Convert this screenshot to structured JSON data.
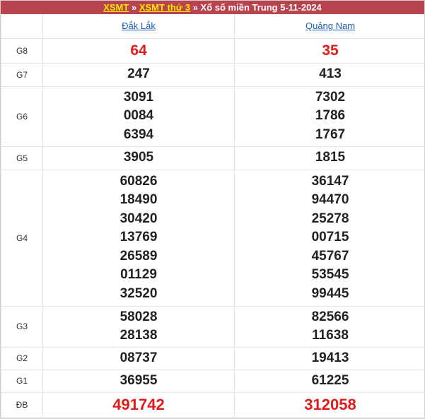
{
  "header": {
    "link1": "XSMT",
    "sep1": "»",
    "link2": "XSMT thứ 3",
    "sep2": "»",
    "title": "Xổ số miền Trung 5-11-2024"
  },
  "provinces": [
    "Đắk Lắk",
    "Quảng Nam"
  ],
  "prizes": [
    {
      "label": "G8",
      "dl": [
        "64"
      ],
      "qn": [
        "35"
      ]
    },
    {
      "label": "G7",
      "dl": [
        "247"
      ],
      "qn": [
        "413"
      ]
    },
    {
      "label": "G6",
      "dl": [
        "3091",
        "0084",
        "6394"
      ],
      "qn": [
        "7302",
        "1786",
        "1767"
      ]
    },
    {
      "label": "G5",
      "dl": [
        "3905"
      ],
      "qn": [
        "1815"
      ]
    },
    {
      "label": "G4",
      "dl": [
        "60826",
        "18490",
        "30420",
        "13769",
        "26589",
        "01129",
        "32520"
      ],
      "qn": [
        "36147",
        "94470",
        "25278",
        "00715",
        "45767",
        "53545",
        "99445"
      ]
    },
    {
      "label": "G3",
      "dl": [
        "58028",
        "28138"
      ],
      "qn": [
        "82566",
        "11638"
      ]
    },
    {
      "label": "G2",
      "dl": [
        "08737"
      ],
      "qn": [
        "19413"
      ]
    },
    {
      "label": "G1",
      "dl": [
        "36955"
      ],
      "qn": [
        "61225"
      ]
    },
    {
      "label": "ĐB",
      "dl": [
        "491742"
      ],
      "qn": [
        "312058"
      ]
    }
  ],
  "colors": {
    "title_bar": "#b8424e",
    "link_yellow": "#ffea00",
    "highlight_red": "#e21b1b",
    "province_blue": "#1a5fb4"
  }
}
